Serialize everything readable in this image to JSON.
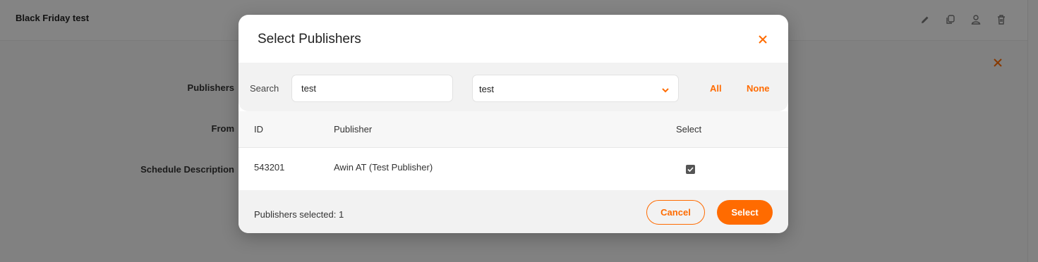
{
  "page": {
    "title": "Black Friday test",
    "form_labels": {
      "publishers": "Publishers",
      "from": "From",
      "schedule_description": "Schedule Description"
    },
    "header_icons": [
      "pencil-icon",
      "copy-icon",
      "user-icon",
      "trash-icon"
    ],
    "close_icon": "close-icon"
  },
  "modal": {
    "title": "Select Publishers",
    "close_icon": "close-icon",
    "search": {
      "label": "Search",
      "value": "test",
      "placeholder": ""
    },
    "filter_select": {
      "value": "test"
    },
    "links": {
      "all": "All",
      "none": "None"
    },
    "table": {
      "headers": {
        "id": "ID",
        "publisher": "Publisher",
        "select": "Select"
      },
      "rows": [
        {
          "id": "543201",
          "publisher": "Awin AT (Test Publisher)",
          "selected": true
        }
      ]
    },
    "footer": {
      "count_text": "Publishers selected: 1",
      "cancel_label": "Cancel",
      "select_label": "Select"
    }
  },
  "colors": {
    "accent": "#ff6b00",
    "overlay": "rgba(0,0,0,0.47)"
  }
}
